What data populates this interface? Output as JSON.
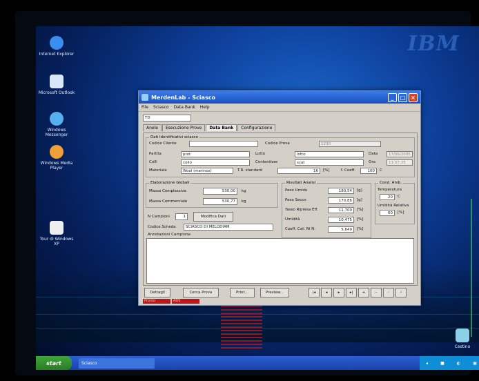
{
  "desktop": {
    "wordmark": "IBM",
    "icons": [
      {
        "label": "Internet Explorer",
        "color": "#3a8ef0"
      },
      {
        "label": "Microsoft Outlook",
        "color": "#d8e6f8"
      },
      {
        "label": "Windows Messenger",
        "color": "#56b0f0"
      },
      {
        "label": "Windows Media Player",
        "color": "#f0a038"
      },
      {
        "label": "Tour di Windows XP",
        "color": "#eeeeee"
      },
      {
        "label": "Cestino",
        "color": "#8cd0e8"
      }
    ]
  },
  "window": {
    "title": "MerdenLab - Sciasco",
    "menu": [
      "File",
      "Sciasco",
      "Data Bank",
      "Help"
    ],
    "record_code": "TD",
    "tabs": [
      "Anele",
      "Esecuzione Prove",
      "Data Bank",
      "Configurazione"
    ],
    "active_tab": "Data Bank",
    "ident": {
      "group_title": "Dati Identificativi sciasco",
      "codice_cliente_label": "Codice Cliente",
      "codice_cliente_value": "",
      "codice_prova_label": "Codice Prova",
      "codice_prova_value": "1230",
      "partita_label": "Partita",
      "partita_value": "prot",
      "lotto_label": "Lotto",
      "lotto_value": "lotto",
      "data_label": "Data",
      "data_value": "17/06/2005",
      "colli_label": "Colli",
      "colli_value": "collo",
      "contenitore_label": "Contenitore",
      "contenitore_value": "scat",
      "ora_label": "Ora",
      "ora_value": "11:07:25",
      "materiale_label": "Materiale",
      "materiale_value": "Wool (merinos)",
      "tr_standard_label": "T.R. standard",
      "tr_standard_value": "16",
      "tr_unit": "[%]",
      "coeff_label": "f. Coeff.",
      "coeff_value": "100",
      "coeff_unit": "C"
    },
    "elaborazione": {
      "group_title": "Elaborazione Globali",
      "massa_complessiva_label": "Massa Complessiva",
      "massa_complessiva_value": "530,00",
      "massa_commerciale_label": "Massa Commerciale",
      "massa_commerciale_value": "530,77",
      "unit": "kg"
    },
    "risultati": {
      "group_title": "Risultati Analisi",
      "rows": [
        {
          "label": "Peso Umido",
          "value": "180,54",
          "unit": "[g]"
        },
        {
          "label": "Peso Secco",
          "value": "170,86",
          "unit": "[g]"
        },
        {
          "label": "Tasso Ripresa Eff.",
          "value": "11,700",
          "unit": "[%]"
        },
        {
          "label": "Umidità",
          "value": "10,475",
          "unit": "[%]"
        },
        {
          "label": "Coeff. Cat. Ni N.",
          "value": "5,649",
          "unit": "[%]"
        }
      ]
    },
    "ambiente": {
      "group_title": "Cond. Amb.",
      "temperatura_label": "Temperatura",
      "temperatura_value": "20",
      "temperatura_unit": "C",
      "umidita_label": "Umidità Relativa",
      "umidita_value": "60",
      "umidita_unit": "[%]"
    },
    "campioni": {
      "n_label": "N Campioni",
      "n_value": "1",
      "modifica_label": "Modifica Dati",
      "codice_scheda_label": "Codice Scheda",
      "codice_scheda_value": "SCIASCO DI MELODIAM",
      "annotazioni_label": "Annotazioni Campione",
      "annotazioni_value": ""
    },
    "toolbar": {
      "dettagli": "Dettagli",
      "cerca": "Cerca Prova",
      "print": "Print...",
      "preview": "Preview...",
      "nav": [
        "|◂",
        "◂",
        "▸",
        "▸|",
        "+",
        "–",
        "✓",
        "✗"
      ]
    },
    "status_cells": [
      "Pronto",
      "ADS"
    ]
  },
  "taskbar": {
    "start_label": "start",
    "task_label": "Sciasco",
    "tray_items": [
      "◂",
      "■",
      "◐",
      "▣"
    ]
  }
}
